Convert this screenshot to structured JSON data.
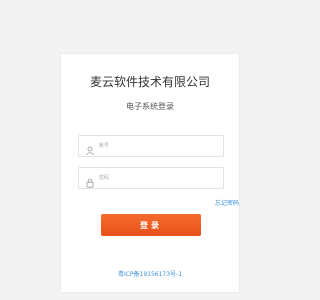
{
  "header": {
    "company_name": "麦云软件技术有限公司",
    "system_title": "电子系统登录"
  },
  "form": {
    "account_placeholder": "账号",
    "password_placeholder": "密码",
    "forgot_password_label": "忘记密码",
    "login_button_label": "登录"
  },
  "footer": {
    "icp_text": "粤ICP备19156173号-1"
  },
  "icons": {
    "account": "user-icon",
    "password": "lock-icon"
  },
  "colors": {
    "accent": "#e8521a",
    "link": "#3a8fd9"
  }
}
